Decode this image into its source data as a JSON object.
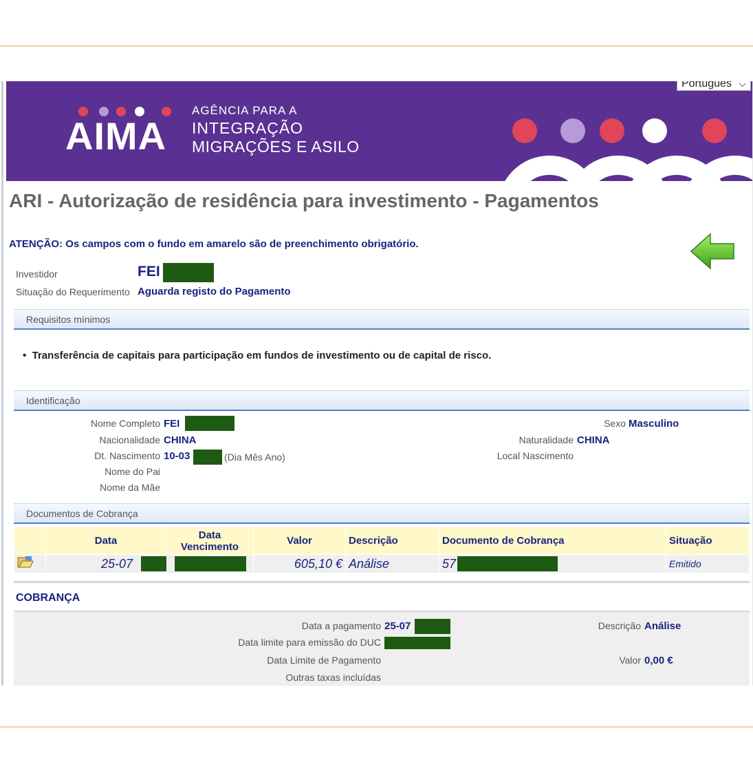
{
  "header": {
    "language": "Português",
    "logo_text": "AIMA",
    "agency_line1": "AGÊNCIA PARA A",
    "agency_line2": "INTEGRAÇÃO",
    "agency_line3": "MIGRAÇÕES E ASILO",
    "colors": {
      "banner": "#5a3192",
      "dot_pink": "#e0455a",
      "dot_lilac": "#b79bd6",
      "dot_white": "#ffffff"
    }
  },
  "page": {
    "title": "ARI - Autorização de residência para investimento - Pagamentos",
    "attention": "ATENÇÃO: Os campos com o fundo em amarelo são de preenchimento obrigatório."
  },
  "summary": {
    "investor_label": "Investidor",
    "investor_value": "FEI",
    "status_label": "Situação do Requerimento",
    "status_value": "Aguarda registo do Pagamento"
  },
  "requirements": {
    "title": "Requisitos mínimos",
    "items": [
      "Transferência de capitais para participação em fundos de investimento ou de capital de risco."
    ]
  },
  "identification": {
    "title": "Identificação",
    "full_name_label": "Nome Completo",
    "full_name_value": "FEI",
    "nationality_label": "Nacionalidade",
    "nationality_value": "CHINA",
    "birth_label": "Dt. Nascimento",
    "birth_value": "10-03",
    "birth_hint": "(Dia Mês Ano)",
    "father_label": "Nome do Pai",
    "mother_label": "Nome da Mãe",
    "sex_label": "Sexo",
    "sex_value": "Masculino",
    "naturality_label": "Naturalidade",
    "naturality_value": "CHINA",
    "birthplace_label": "Local Nascimento"
  },
  "billing_documents": {
    "title": "Documentos de Cobrança",
    "headers": [
      "Data",
      "Data Vencimento",
      "Valor",
      "Descrição",
      "Documento de Cobrança",
      "Situação"
    ],
    "rows": [
      {
        "date": "25-07",
        "due": "",
        "value": "605,10 €",
        "description": "Análise",
        "document": "57",
        "status": "Emitido"
      }
    ]
  },
  "cobranca": {
    "title": "COBRANÇA",
    "payment_date_label": "Data a pagamento",
    "payment_date_value": "25-07",
    "duc_limit_label": "Data limite para emissão do DUC",
    "payment_limit_label": "Data Limite de Pagamento",
    "other_fees_label": "Outras taxas incluídas",
    "description_label": "Descrição",
    "description_value": "Análise",
    "value_label": "Valor",
    "value_value": "0,00 €"
  }
}
